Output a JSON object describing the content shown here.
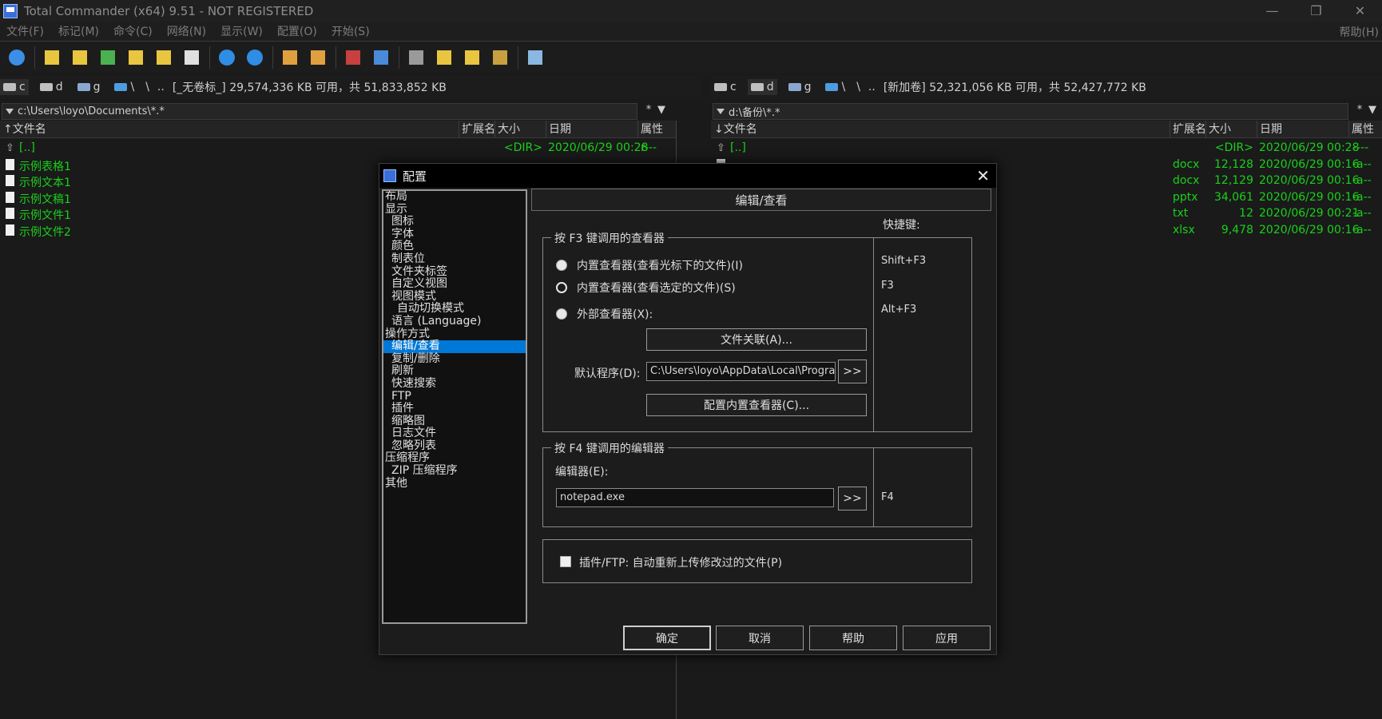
{
  "window": {
    "title": "Total Commander (x64) 9.51 - NOT REGISTERED",
    "controls": {
      "minimize": "—",
      "restore": "❐",
      "close": "✕"
    }
  },
  "menu": {
    "items": [
      "文件(F)",
      "标记(M)",
      "命令(C)",
      "网络(N)",
      "显示(W)",
      "配置(O)",
      "开始(S)"
    ],
    "help": "帮助(H)"
  },
  "toolbar": {
    "buttons": [
      {
        "name": "refresh-icon",
        "color": "#3b8fe6"
      },
      {
        "name": "brief-view-icon",
        "color": "#e8c640"
      },
      {
        "name": "full-view-icon",
        "color": "#e8c640"
      },
      {
        "name": "thumbnails-icon",
        "color": "#4bb04f"
      },
      {
        "name": "tree-icon",
        "color": "#e8c640"
      },
      {
        "name": "compare-dirs-icon",
        "color": "#e8c640"
      },
      {
        "name": "invert-selection-icon",
        "color": "#e0e0e0"
      },
      {
        "name": "back-icon",
        "color": "#2f8de4"
      },
      {
        "name": "forward-icon",
        "color": "#2f8de4"
      },
      {
        "name": "pack-icon",
        "color": "#e0a040"
      },
      {
        "name": "unpack-icon",
        "color": "#e0a040"
      },
      {
        "name": "ftp-connect-icon",
        "color": "#c84040"
      },
      {
        "name": "ftp-new-icon",
        "color": "#4a8ad8"
      },
      {
        "name": "find-icon",
        "color": "#9a9a9a"
      },
      {
        "name": "multi-rename-icon",
        "color": "#e8c640"
      },
      {
        "name": "sync-dirs-icon",
        "color": "#e8c640"
      },
      {
        "name": "copy-names-icon",
        "color": "#c8a040"
      },
      {
        "name": "notepad-icon",
        "color": "#8ab8e0"
      }
    ]
  },
  "left_panel": {
    "drives": [
      {
        "letter": "c",
        "active": true
      },
      {
        "letter": "d",
        "active": false
      },
      {
        "letter": "g",
        "active": false
      },
      {
        "letter": "\\",
        "active": false
      }
    ],
    "root": "\\",
    "up": "..",
    "volume_info": "[_无卷标_]  29,574,336 KB 可用，共 51,833,852 KB",
    "path": "c:\\Users\\loyo\\Documents\\*.*",
    "path_btn_star": "*",
    "path_btn_down": "▼",
    "columns": {
      "name": "文件名",
      "ext": "扩展名",
      "size": "大小",
      "date": "日期",
      "attr": "属性"
    },
    "rows": [
      {
        "name": "[..]",
        "ext": "",
        "size": "<DIR>",
        "date": "2020/06/29 00:28",
        "attr": "r---"
      },
      {
        "name": "示例表格1",
        "ext": "",
        "size": "",
        "date": "",
        "attr": ""
      },
      {
        "name": "示例文本1",
        "ext": "",
        "size": "",
        "date": "",
        "attr": ""
      },
      {
        "name": "示例文稿1",
        "ext": "",
        "size": "",
        "date": "",
        "attr": ""
      },
      {
        "name": "示例文件1",
        "ext": "",
        "size": "",
        "date": "",
        "attr": ""
      },
      {
        "name": "示例文件2",
        "ext": "",
        "size": "",
        "date": "",
        "attr": ""
      }
    ]
  },
  "right_panel": {
    "drives": [
      {
        "letter": "c",
        "active": false
      },
      {
        "letter": "d",
        "active": true
      },
      {
        "letter": "g",
        "active": false
      },
      {
        "letter": "\\",
        "active": false
      }
    ],
    "root": "\\",
    "up": "..",
    "volume_info": "[新加卷]  52,321,056 KB 可用，共 52,427,772 KB",
    "path": "d:\\备份\\*.*",
    "path_btn_star": "*",
    "path_btn_down": "▼",
    "columns": {
      "name": "文件名",
      "ext": "扩展名",
      "size": "大小",
      "date": "日期",
      "attr": "属性"
    },
    "rows": [
      {
        "name": "[..]",
        "ext": "",
        "size": "<DIR>",
        "date": "2020/06/29 00:28",
        "attr": "----"
      },
      {
        "name": "",
        "ext": "docx",
        "size": "12,128",
        "date": "2020/06/29 00:16",
        "attr": "-a--"
      },
      {
        "name": "",
        "ext": "docx",
        "size": "12,129",
        "date": "2020/06/29 00:16",
        "attr": "-a--"
      },
      {
        "name": "",
        "ext": "pptx",
        "size": "34,061",
        "date": "2020/06/29 00:16",
        "attr": "-a--"
      },
      {
        "name": "",
        "ext": "txt",
        "size": "12",
        "date": "2020/06/29 00:21",
        "attr": "-a--"
      },
      {
        "name": "",
        "ext": "xlsx",
        "size": "9,478",
        "date": "2020/06/29 00:16",
        "attr": "-a--"
      }
    ]
  },
  "dialog": {
    "title": "配置",
    "close": "✕",
    "tree": [
      {
        "label": "布局",
        "level": 1
      },
      {
        "label": "显示",
        "level": 1
      },
      {
        "label": "图标",
        "level": 2
      },
      {
        "label": "字体",
        "level": 2
      },
      {
        "label": "颜色",
        "level": 2
      },
      {
        "label": "制表位",
        "level": 2
      },
      {
        "label": "文件夹标签",
        "level": 2
      },
      {
        "label": "自定义视图",
        "level": 2
      },
      {
        "label": "视图模式",
        "level": 2
      },
      {
        "label": "自动切换模式",
        "level": 3
      },
      {
        "label": "语言 (Language)",
        "level": 2
      },
      {
        "label": "操作方式",
        "level": 1
      },
      {
        "label": "编辑/查看",
        "level": 2,
        "selected": true
      },
      {
        "label": "复制/删除",
        "level": 2
      },
      {
        "label": "刷新",
        "level": 2
      },
      {
        "label": "快速搜索",
        "level": 2
      },
      {
        "label": "FTP",
        "level": 2
      },
      {
        "label": "插件",
        "level": 2
      },
      {
        "label": "缩略图",
        "level": 2
      },
      {
        "label": "日志文件",
        "level": 2
      },
      {
        "label": "忽略列表",
        "level": 2
      },
      {
        "label": "压缩程序",
        "level": 1
      },
      {
        "label": "ZIP 压缩程序",
        "level": 2
      },
      {
        "label": "其他",
        "level": 1
      }
    ],
    "page_title": "编辑/查看",
    "hotkey_title": "快捷键:",
    "f3_group": {
      "legend": "按 F3 键调用的查看器",
      "options": [
        {
          "label": "内置查看器(查看光标下的文件)(I)",
          "hotkey": "Shift+F3",
          "checked": false
        },
        {
          "label": "内置查看器(查看选定的文件)(S)",
          "hotkey": "F3",
          "checked": true
        },
        {
          "label": "外部查看器(X):",
          "hotkey": "Alt+F3",
          "checked": false
        }
      ],
      "file_assoc_btn": "文件关联(A)...",
      "default_prog_label": "默认程序(D):",
      "default_prog_value": "C:\\Users\\loyo\\AppData\\Local\\Programs",
      "browse_btn": ">>",
      "config_viewer_btn": "配置内置查看器(C)..."
    },
    "f4_group": {
      "legend": "按 F4 键调用的编辑器",
      "editor_label": "编辑器(E):",
      "editor_value": "notepad.exe",
      "browse_btn": ">>",
      "hotkey": "F4"
    },
    "plugin_checkbox": {
      "label": "插件/FTP: 自动重新上传修改过的文件(P)",
      "checked": false
    },
    "buttons": {
      "ok": "确定",
      "cancel": "取消",
      "help": "帮助",
      "apply": "应用"
    }
  }
}
